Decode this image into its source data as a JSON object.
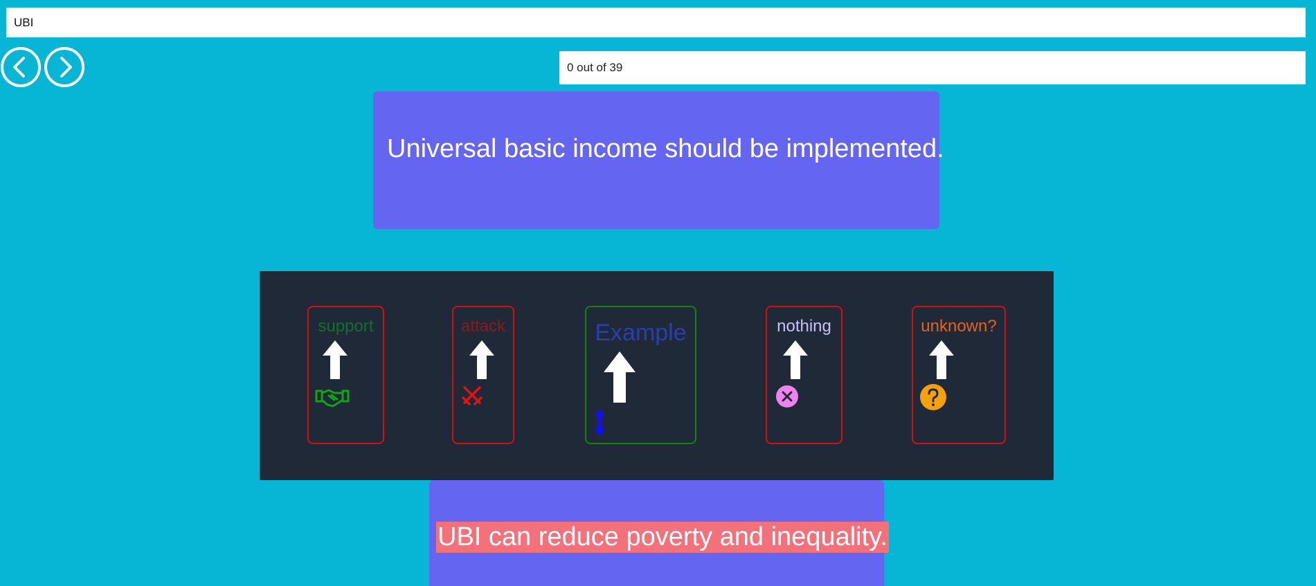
{
  "topic": {
    "value": "UBI"
  },
  "navigation": {
    "prev_icon": "chevron-left-icon",
    "next_icon": "chevron-right-icon"
  },
  "progress": {
    "label": "0 out of 39",
    "current": 0,
    "total": 39
  },
  "claim": {
    "text": "Universal basic income should be implemented."
  },
  "relations": [
    {
      "label": "support",
      "color": "#136f2e",
      "icon": "handshake-icon",
      "icon_color": "#13a313"
    },
    {
      "label": "attack",
      "color": "#8b1a1a",
      "icon": "crossed-swords-icon",
      "icon_color": "#e11212"
    },
    {
      "label": "Example",
      "color": "#2a3fae",
      "icon": "double-arrow-vertical-icon",
      "icon_color": "#1010f0"
    },
    {
      "label": "nothing",
      "color": "#c7c3f8",
      "icon": "x-circle-icon",
      "icon_color": "#ee82ee"
    },
    {
      "label": "unknown?",
      "color": "#e0661d",
      "icon": "question-circle-icon",
      "icon_color": "#f6a10a"
    }
  ],
  "reason": {
    "text": "UBI can reduce poverty and inequality.",
    "highlight_color": "#f2717a"
  }
}
